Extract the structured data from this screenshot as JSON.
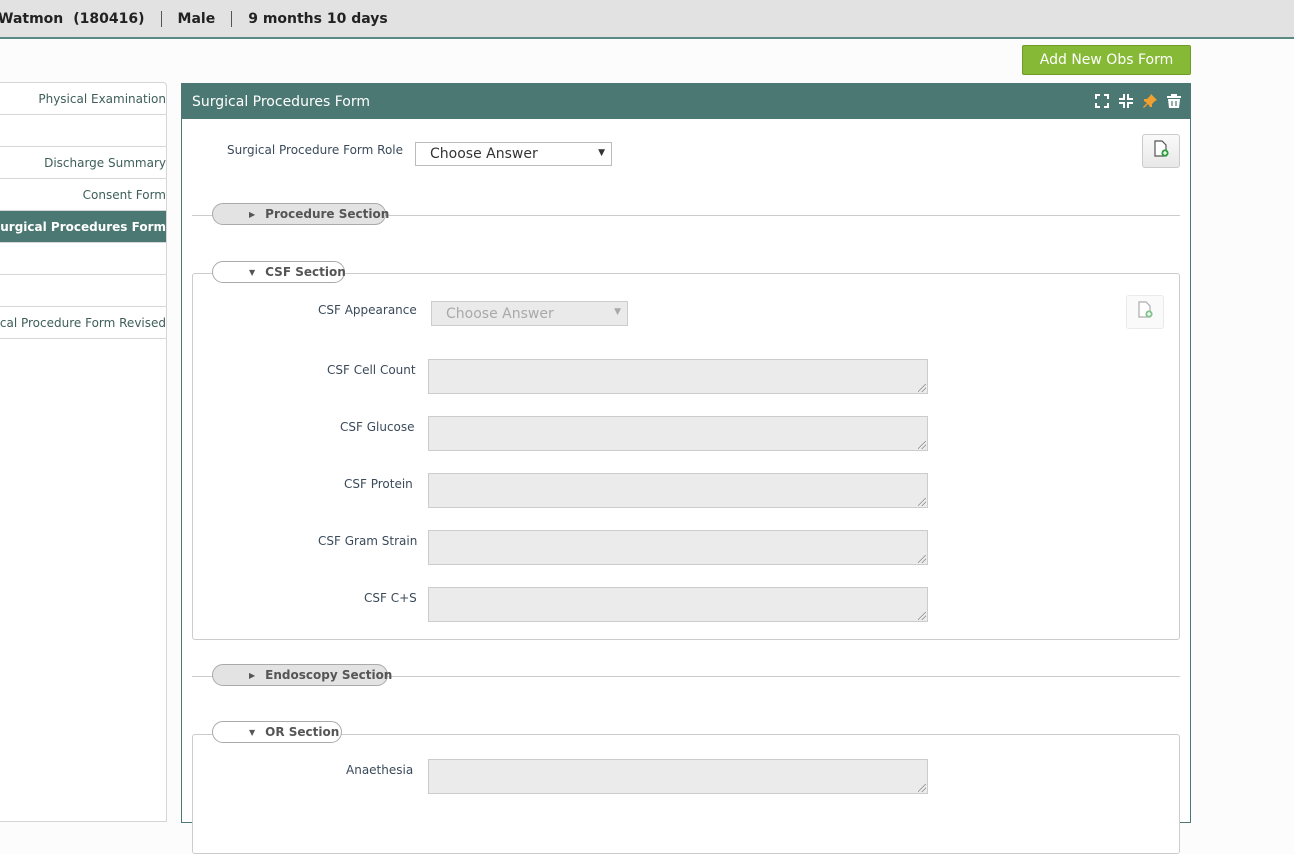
{
  "patient": {
    "name": "Watmon",
    "id": "(180416)",
    "gender": "Male",
    "age": "9 months 10 days"
  },
  "actions": {
    "add_form": "Add New Obs Form"
  },
  "sidebar": {
    "items": [
      {
        "label": "Physical Examination",
        "active": false
      },
      {
        "label": "",
        "active": false
      },
      {
        "label": "Discharge Summary",
        "active": false
      },
      {
        "label": "Consent Form",
        "active": false
      },
      {
        "label": "Surgical Procedures Form",
        "active": true
      },
      {
        "label": "",
        "active": false
      },
      {
        "label": "",
        "active": false
      },
      {
        "label": "Surgical Procedure Form Revised",
        "active": false
      }
    ]
  },
  "form": {
    "title": "Surgical Procedures Form",
    "role_label": "Surgical Procedure Form Role",
    "role_value": "Choose Answer",
    "sections": {
      "procedure": "Procedure Section",
      "csf": "CSF Section",
      "endoscopy": "Endoscopy Section",
      "or": "OR Section"
    },
    "csf": {
      "appearance_label": "CSF Appearance",
      "appearance_value": "Choose Answer",
      "cell_count": "CSF Cell Count",
      "glucose": "CSF Glucose",
      "protein": "CSF Protein",
      "gram_strain": "CSF Gram Strain",
      "cs": "CSF C+S"
    },
    "or": {
      "anaesthesia": "Anaethesia"
    }
  },
  "colors": {
    "primary": "#4b7873",
    "accent_green": "#86b935",
    "pin_orange": "#f0a030"
  }
}
